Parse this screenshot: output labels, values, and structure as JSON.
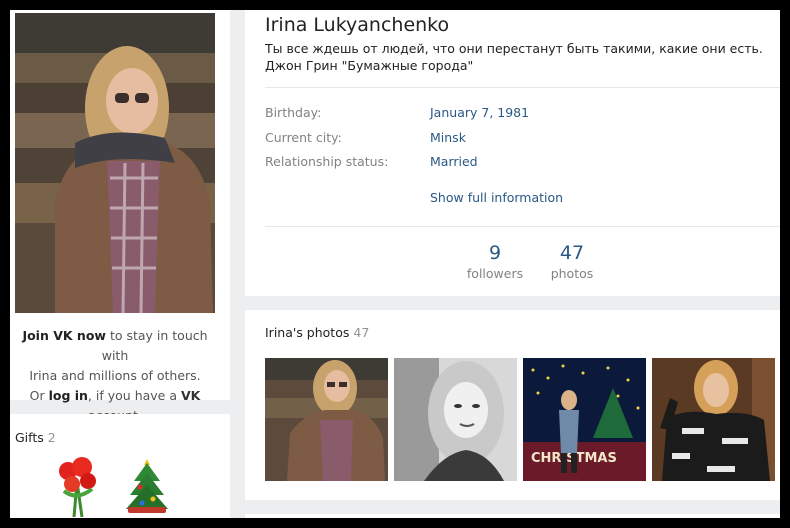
{
  "profile": {
    "name": "Irina Lukyanchenko",
    "status": "Ты все ждешь от людей, что они перестанут быть такими, какие они есть. Джон Грин \"Бумажные города\""
  },
  "info": [
    {
      "label": "Birthday:",
      "value": "January 7, 1981"
    },
    {
      "label": "Current city:",
      "value": "Minsk"
    },
    {
      "label": "Relationship status:",
      "value": "Married"
    }
  ],
  "show_full": "Show full information",
  "counters": [
    {
      "number": "9",
      "label": "followers"
    },
    {
      "number": "47",
      "label": "photos"
    }
  ],
  "join": {
    "join_link": "Join VK now",
    "line1_rest": " to stay in touch with",
    "line2": "Irina and millions of others.",
    "line3_prefix": "Or ",
    "login_link": "log in",
    "line3_mid": ", if you have a ",
    "vk": "VK",
    "line3_suffix": " account."
  },
  "gifts": {
    "title": "Gifts",
    "count": "2",
    "items": [
      "rose-bouquet-gift-icon",
      "christmas-tree-gift-icon"
    ]
  },
  "photos": {
    "title": "Irina's photos",
    "count": "47",
    "thumb_text_3": "CHRISTMAS"
  },
  "colors": {
    "link": "#2a5885",
    "background": "#edeef0",
    "muted": "#828282"
  }
}
